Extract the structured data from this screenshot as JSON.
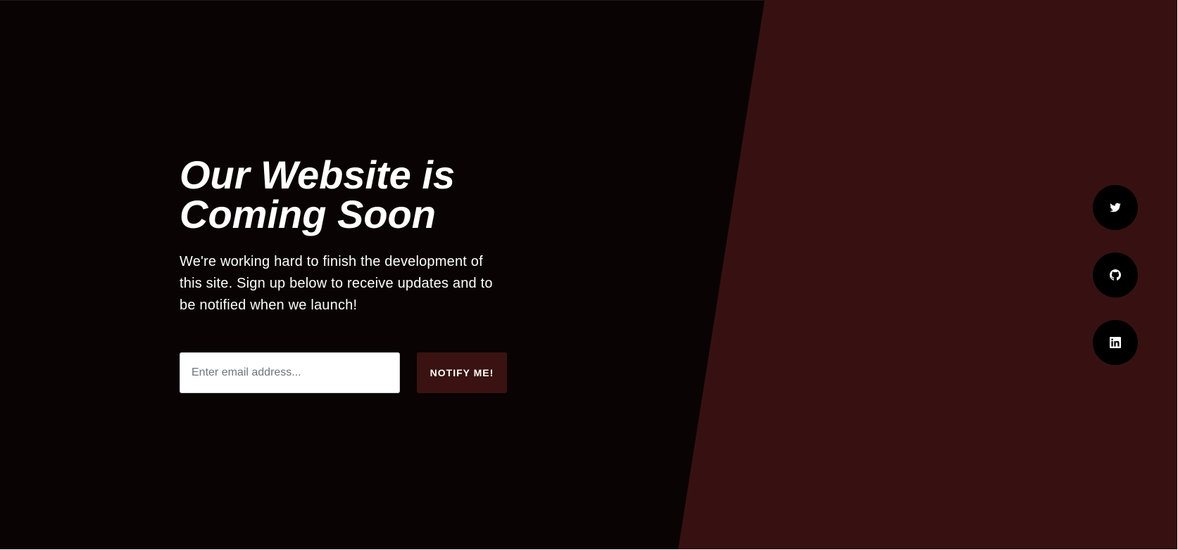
{
  "colors": {
    "background": "#0a0303",
    "accent_panel": "#371111",
    "button_bg": "#3a1212",
    "social_bg": "#000000",
    "text": "#ffffff"
  },
  "hero": {
    "headline_line1": "Our Website is",
    "headline_line2": "Coming Soon",
    "lead": "We're working hard to finish the development of this site. Sign up below to receive updates and to be notified when we launch!"
  },
  "signup": {
    "email_placeholder": "Enter email address...",
    "email_value": "",
    "button_label": "NOTIFY ME!"
  },
  "social": {
    "items": [
      {
        "icon": "twitter-icon"
      },
      {
        "icon": "github-icon"
      },
      {
        "icon": "linkedin-icon"
      }
    ]
  }
}
